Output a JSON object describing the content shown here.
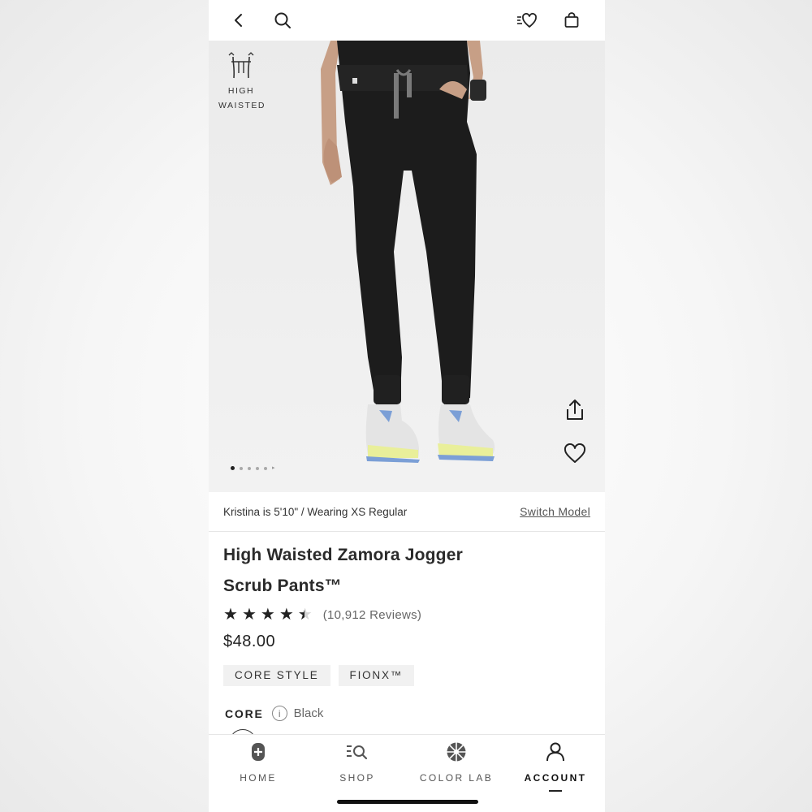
{
  "top_bar": {
    "icons": [
      "chevron-left-icon",
      "search-icon",
      "wishlist-heart-icon",
      "shopping-bag-icon"
    ]
  },
  "hero": {
    "badge_line1": "HIGH",
    "badge_line2": "WAISTED",
    "image_count": 5,
    "active_image": 1
  },
  "model": {
    "info": "Kristina is 5'10\"  / Wearing XS Regular",
    "switch_label": "Switch Model"
  },
  "product": {
    "title_line1": "High Waisted Zamora Jogger",
    "title_line2": "Scrub Pants™",
    "rating": 4.5,
    "reviews": "(10,912 Reviews)",
    "price": "$48.00",
    "tags": [
      "CORE STYLE",
      "FIONX™"
    ],
    "color_group": "CORE",
    "color_name": "Black"
  },
  "bottom_nav": {
    "items": [
      {
        "label": "HOME",
        "icon": "home-plus-icon"
      },
      {
        "label": "SHOP",
        "icon": "shop-search-icon"
      },
      {
        "label": "COLOR LAB",
        "icon": "color-wheel-icon"
      },
      {
        "label": "ACCOUNT",
        "icon": "account-icon"
      }
    ],
    "active": "ACCOUNT"
  },
  "colors": {
    "pants": "#1c1c1c",
    "drawstring": "#7a7a7a",
    "shoe_accent": "#7b9fd6",
    "shoe_sole": "#e9ef9a"
  }
}
